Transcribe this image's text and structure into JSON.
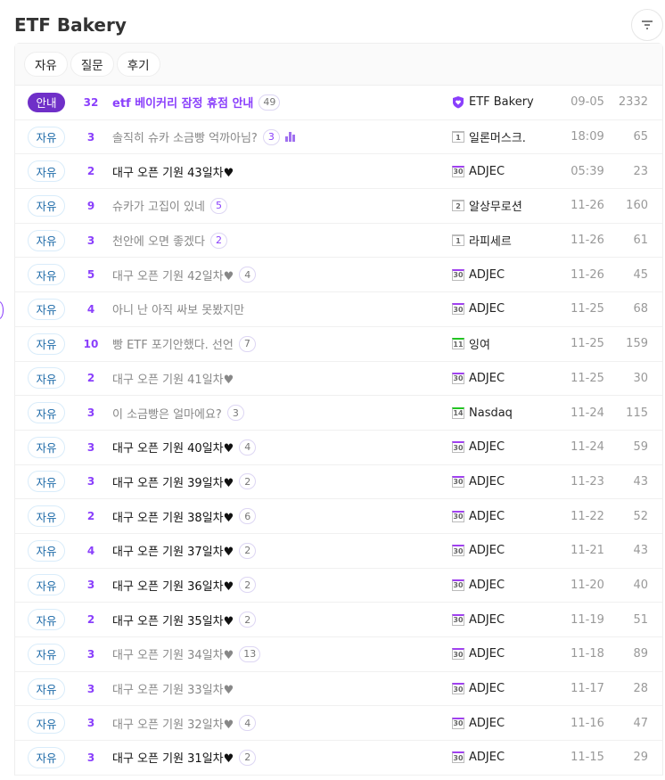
{
  "header": {
    "title": "ETF Bakery"
  },
  "tabs": [
    "자유",
    "질문",
    "후기"
  ],
  "colors": {
    "accent": "#8a3ffc",
    "lv_low": "#bbbbbb",
    "lv_mid": "#22c522",
    "lv_high": "#a040f0"
  },
  "posts": [
    {
      "badge": "안내",
      "notice": true,
      "count": "32",
      "title": "etf 베이커리 잠정 휴점 안내",
      "comments": "49",
      "level": "shield",
      "author": "ETF Bakery",
      "date": "09-05",
      "views": "2332"
    },
    {
      "badge": "자유",
      "read": true,
      "count": "3",
      "title": "솔직히 슈카 소금빵 억까아님?",
      "comments": "3",
      "hot": true,
      "poll": true,
      "level": "1",
      "author": "일론머스크.",
      "date": "18:09",
      "views": "65"
    },
    {
      "badge": "자유",
      "count": "2",
      "title": "대구 오픈 기원 43일차♥",
      "level": "30",
      "author": "ADJEC",
      "date": "05:39",
      "views": "23"
    },
    {
      "badge": "자유",
      "read": true,
      "count": "9",
      "title": "슈카가 고집이 있네",
      "comments": "5",
      "hot": true,
      "level": "2",
      "author": "알상무로션",
      "date": "11-26",
      "views": "160"
    },
    {
      "badge": "자유",
      "read": true,
      "count": "3",
      "title": "천안에 오면 좋겠다",
      "comments": "2",
      "hot": true,
      "level": "1",
      "author": "라피세르",
      "date": "11-26",
      "views": "61"
    },
    {
      "badge": "자유",
      "read": true,
      "count": "5",
      "title": "대구 오픈 기원 42일차♥",
      "comments": "4",
      "level": "30",
      "author": "ADJEC",
      "date": "11-26",
      "views": "45"
    },
    {
      "badge": "자유",
      "read": true,
      "count": "4",
      "title": "아니 난 아직 싸보 못봤지만",
      "level": "30",
      "author": "ADJEC",
      "date": "11-25",
      "views": "68"
    },
    {
      "badge": "자유",
      "read": true,
      "count": "10",
      "title": "빵 ETF 포기안했다. 선언",
      "comments": "7",
      "level": "11",
      "author": "잉여",
      "date": "11-25",
      "views": "159"
    },
    {
      "badge": "자유",
      "read": true,
      "count": "2",
      "title": "대구 오픈 기원 41일차♥",
      "level": "30",
      "author": "ADJEC",
      "date": "11-25",
      "views": "30"
    },
    {
      "badge": "자유",
      "read": true,
      "count": "3",
      "title": "이 소금빵은 얼마에요?",
      "comments": "3",
      "level": "14",
      "author": "Nasdaq",
      "date": "11-24",
      "views": "115"
    },
    {
      "badge": "자유",
      "count": "3",
      "title": "대구 오픈 기원 40일차♥",
      "comments": "4",
      "level": "30",
      "author": "ADJEC",
      "date": "11-24",
      "views": "59"
    },
    {
      "badge": "자유",
      "count": "3",
      "title": "대구 오픈 기원 39일차♥",
      "comments": "2",
      "level": "30",
      "author": "ADJEC",
      "date": "11-23",
      "views": "43"
    },
    {
      "badge": "자유",
      "count": "2",
      "title": "대구 오픈 기원 38일차♥",
      "comments": "6",
      "level": "30",
      "author": "ADJEC",
      "date": "11-22",
      "views": "52"
    },
    {
      "badge": "자유",
      "count": "4",
      "title": "대구 오픈 기원 37일차♥",
      "comments": "2",
      "level": "30",
      "author": "ADJEC",
      "date": "11-21",
      "views": "43"
    },
    {
      "badge": "자유",
      "count": "3",
      "title": "대구 오픈 기원 36일차♥",
      "comments": "2",
      "level": "30",
      "author": "ADJEC",
      "date": "11-20",
      "views": "40"
    },
    {
      "badge": "자유",
      "count": "2",
      "title": "대구 오픈 기원 35일차♥",
      "comments": "2",
      "level": "30",
      "author": "ADJEC",
      "date": "11-19",
      "views": "51"
    },
    {
      "badge": "자유",
      "read": true,
      "count": "3",
      "title": "대구 오픈 기원 34일차♥",
      "comments": "13",
      "level": "30",
      "author": "ADJEC",
      "date": "11-18",
      "views": "89"
    },
    {
      "badge": "자유",
      "read": true,
      "count": "3",
      "title": "대구 오픈 기원 33일차♥",
      "level": "30",
      "author": "ADJEC",
      "date": "11-17",
      "views": "28"
    },
    {
      "badge": "자유",
      "read": true,
      "count": "3",
      "title": "대구 오픈 기원 32일차♥",
      "comments": "4",
      "level": "30",
      "author": "ADJEC",
      "date": "11-16",
      "views": "47"
    },
    {
      "badge": "자유",
      "count": "3",
      "title": "대구 오픈 기원 31일차♥",
      "comments": "2",
      "level": "30",
      "author": "ADJEC",
      "date": "11-15",
      "views": "29"
    }
  ]
}
